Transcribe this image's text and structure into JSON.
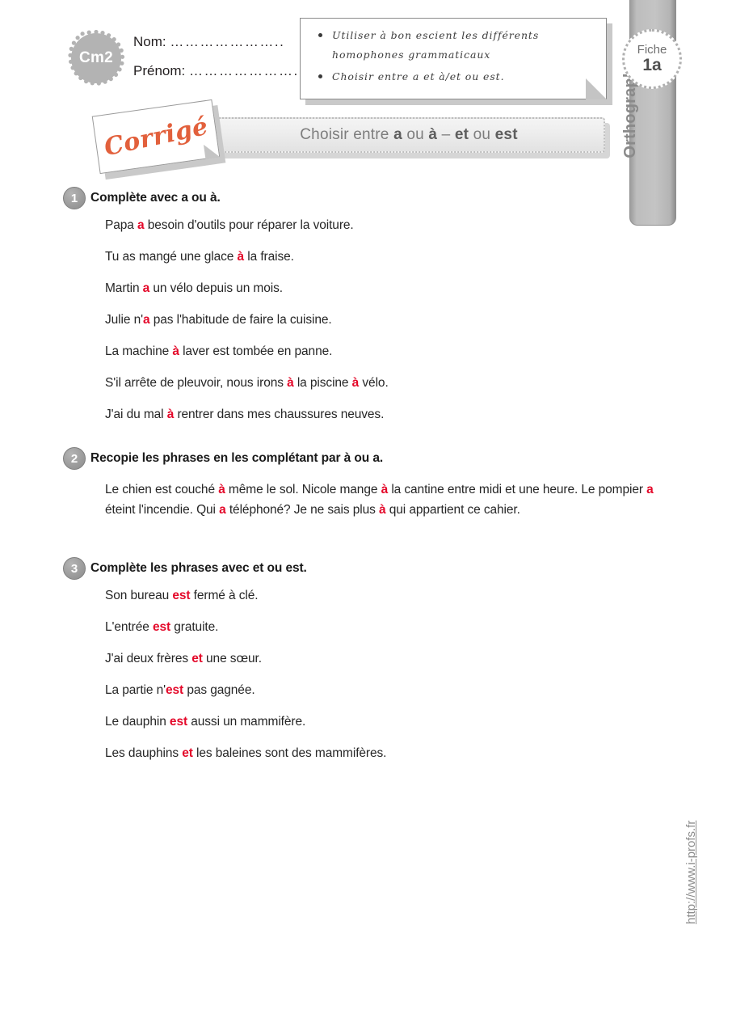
{
  "header": {
    "level_badge": "Cm2",
    "name_label": "Nom:",
    "name_dots": "…………………..",
    "firstname_label": "Prénom:",
    "firstname_dots": "…………………..",
    "fiche_label": "Fiche",
    "fiche_number": "1a",
    "subject_tab": "Orthographe"
  },
  "objectives": {
    "items": [
      "Utiliser à bon escient les différents homophones grammaticaux",
      "Choisir entre a et à/et ou est."
    ]
  },
  "title": {
    "stamp": "Corrigé",
    "part1": "Choisir entre ",
    "bold1": "a",
    "part2": " ou ",
    "bold2": "à",
    "part3": " – ",
    "bold3": "et",
    "part4": " ou ",
    "bold4": "est"
  },
  "exercises": [
    {
      "number": "1",
      "instruction": "Complète avec a ou à.",
      "lines": [
        {
          "before": "Papa ",
          "answer": "a",
          "after": " besoin d'outils pour réparer la voiture."
        },
        {
          "before": "Tu as mangé une glace ",
          "answer": "à",
          "after": " la fraise."
        },
        {
          "before": "Martin ",
          "answer": "a",
          "after": "  un vélo depuis un mois."
        },
        {
          "before": "Julie n'",
          "answer": "a",
          "after": " pas l'habitude de faire la cuisine."
        },
        {
          "before": "La machine ",
          "answer": "à",
          "after": " laver est tombée en panne."
        },
        {
          "before": "S'il arrête de pleuvoir, nous irons ",
          "answer": "à",
          "after": " la piscine ",
          "answer2": "à",
          "after2": " vélo."
        },
        {
          "before": "J'ai du mal ",
          "answer": "à",
          "after": " rentrer dans mes chaussures neuves."
        }
      ]
    },
    {
      "number": "2",
      "instruction": "Recopie les phrases en les complétant par à ou a.",
      "paragraph": [
        {
          "text": "Le chien est couché "
        },
        {
          "answer": "à"
        },
        {
          "text": " même le sol. Nicole mange "
        },
        {
          "answer": "à"
        },
        {
          "text": " la cantine entre midi et une heure. Le pompier "
        },
        {
          "answer": "a"
        },
        {
          "text": " éteint l'incendie. Qui "
        },
        {
          "answer": "a"
        },
        {
          "text": " téléphoné? Je ne sais plus "
        },
        {
          "answer": "à"
        },
        {
          "text": " qui appartient ce cahier."
        }
      ]
    },
    {
      "number": "3",
      "instruction": "Complète les phrases avec et ou est.",
      "lines": [
        {
          "before": "Son bureau ",
          "answer": "est",
          "after": " fermé à clé."
        },
        {
          "before": "L'entrée ",
          "answer": "est",
          "after": " gratuite."
        },
        {
          "before": "J'ai deux frères ",
          "answer": "et",
          "after": " une sœur."
        },
        {
          "before": "La partie n'",
          "answer": "est",
          "after": " pas gagnée."
        },
        {
          "before": "Le dauphin ",
          "answer": "est",
          "after": " aussi un mammifère."
        },
        {
          "before": "Les dauphins ",
          "answer": "et",
          "after": " les baleines sont des mammifères."
        }
      ]
    }
  ],
  "footer": {
    "url": "http://www.i-profs.fr"
  },
  "colors": {
    "answer_red": "#e4092a",
    "stamp_orange": "#e2603c",
    "tab_gray": "#bdbdbd"
  }
}
